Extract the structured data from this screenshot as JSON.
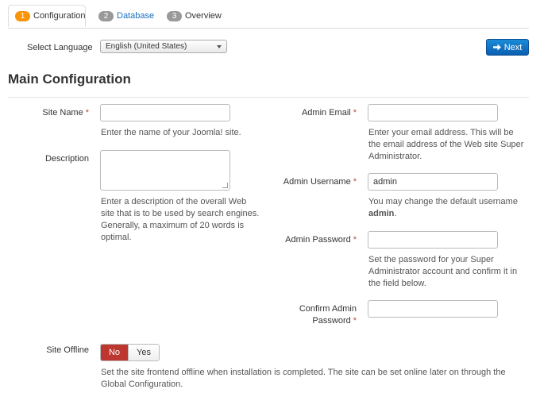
{
  "tabs": [
    {
      "number": "1",
      "label": "Configuration",
      "active": true,
      "badge_color": "#f89406"
    },
    {
      "number": "2",
      "label": "Database",
      "active": false,
      "badge_color": "#999999"
    },
    {
      "number": "3",
      "label": "Overview",
      "active": false,
      "badge_color": "#999999"
    }
  ],
  "language": {
    "label": "Select Language",
    "selected": "English (United States)"
  },
  "next_button": {
    "label": "Next",
    "icon": "arrow-right-icon"
  },
  "section_title": "Main Configuration",
  "left": {
    "site_name": {
      "label": "Site Name",
      "required": "*",
      "value": "",
      "help": "Enter the name of your Joomla! site."
    },
    "description": {
      "label": "Description",
      "value": "",
      "help": "Enter a description of the overall Web site that is to be used by search engines. Generally, a maximum of 20 words is optimal."
    }
  },
  "right": {
    "admin_email": {
      "label": "Admin Email",
      "required": "*",
      "value": "",
      "help": "Enter your email address. This will be the email address of the Web site Super Administrator."
    },
    "admin_username": {
      "label": "Admin Username",
      "required": "*",
      "value": "admin",
      "help_prefix": "You may change the default username",
      "help_bold": "admin",
      "help_suffix": "."
    },
    "admin_password": {
      "label": "Admin Password",
      "required": "*",
      "value": "",
      "help": "Set the password for your Super Administrator account and confirm it in the field below."
    },
    "confirm_password": {
      "label_line1": "Confirm Admin",
      "label_line2": "Password",
      "required": "*",
      "value": ""
    }
  },
  "site_offline": {
    "label": "Site Offline",
    "options": {
      "no": "No",
      "yes": "Yes"
    },
    "selected": "No",
    "help": "Set the site frontend offline when installation is completed. The site can be set online later on through the Global Configuration."
  },
  "colors": {
    "accent": "#0b6bc4",
    "danger": "#bd362f",
    "link": "#1a6fc0"
  }
}
